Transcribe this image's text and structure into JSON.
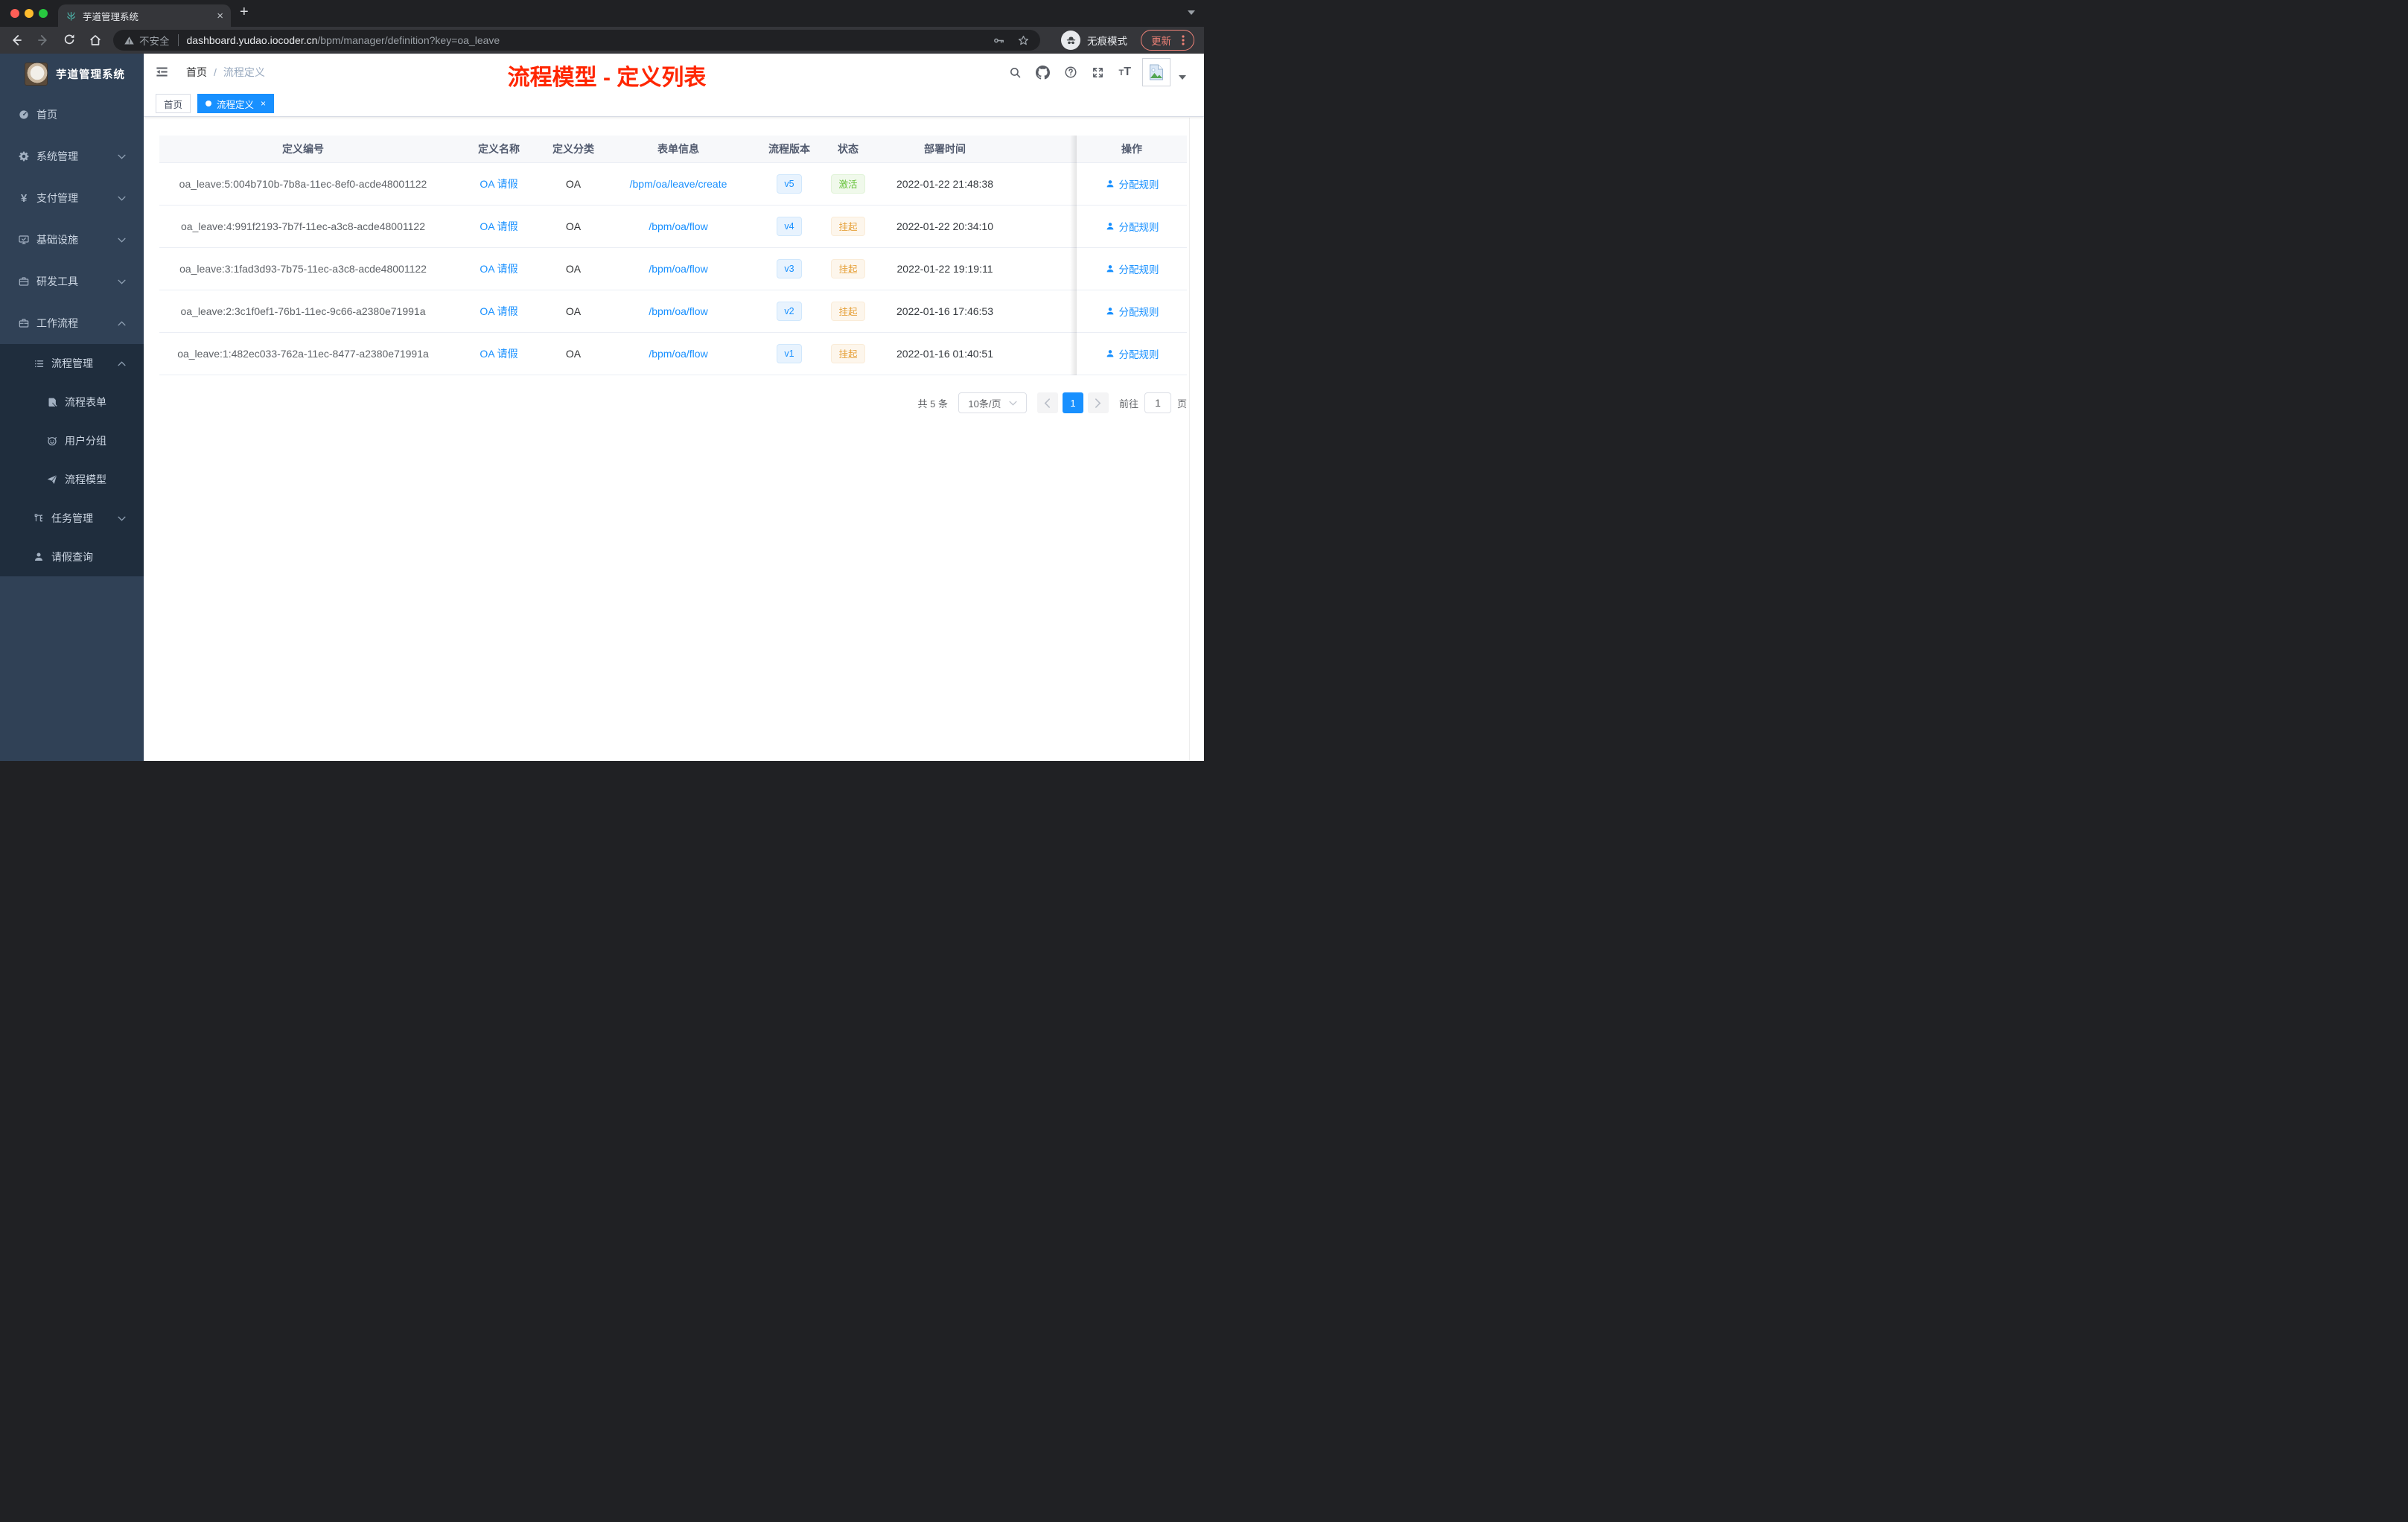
{
  "colors": {
    "accent_blue": "#1890ff",
    "success_green": "#67c23a",
    "warning_orange": "#e6a23c",
    "annotation_red": "#ff2600",
    "sidebar_bg": "#304156",
    "sidebar_nested_bg": "#1f2d3d",
    "chrome_dark": "#202124"
  },
  "browser": {
    "tab_title": "芋道管理系统",
    "close_glyph": "×",
    "newtab_glyph": "+",
    "security_label": "不安全",
    "url_host": "dashboard.yudao.iocoder.cn",
    "url_path": "/bpm/manager/definition?key=oa_leave",
    "incognito_label": "无痕模式",
    "update_label": "更新"
  },
  "sidebar": {
    "logo_title": "芋道管理系统",
    "items": [
      {
        "key": "home",
        "label": "首页",
        "icon": "dashboard-icon",
        "level": 1,
        "chevron": null,
        "nested": false
      },
      {
        "key": "system",
        "label": "系统管理",
        "icon": "gear-icon",
        "level": 1,
        "chevron": "down",
        "nested": false
      },
      {
        "key": "payment",
        "label": "支付管理",
        "icon": "yen-icon",
        "level": 1,
        "chevron": "down",
        "nested": false
      },
      {
        "key": "infrastructure",
        "label": "基础设施",
        "icon": "monitor-icon",
        "level": 1,
        "chevron": "down",
        "nested": false
      },
      {
        "key": "dev-tools",
        "label": "研发工具",
        "icon": "toolbox-icon",
        "level": 1,
        "chevron": "down",
        "nested": false
      },
      {
        "key": "workflow",
        "label": "工作流程",
        "icon": "briefcase-icon",
        "level": 1,
        "chevron": "up",
        "nested": false
      },
      {
        "key": "process-manage",
        "label": "流程管理",
        "icon": "list-icon",
        "level": 2,
        "chevron": "up",
        "nested": true
      },
      {
        "key": "process-form",
        "label": "流程表单",
        "icon": "form-edit-icon",
        "level": 3,
        "chevron": null,
        "nested": true
      },
      {
        "key": "user-group",
        "label": "用户分组",
        "icon": "robot-icon",
        "level": 3,
        "chevron": null,
        "nested": true
      },
      {
        "key": "process-model",
        "label": "流程模型",
        "icon": "paper-plane-icon",
        "level": 3,
        "chevron": null,
        "nested": true
      },
      {
        "key": "task-manage",
        "label": "任务管理",
        "icon": "tree-icon",
        "level": 2,
        "chevron": "down",
        "nested": true
      },
      {
        "key": "leave-query",
        "label": "请假查询",
        "icon": "user-icon",
        "level": 2,
        "chevron": null,
        "nested": true
      }
    ]
  },
  "navbar": {
    "breadcrumb": [
      "首页",
      "流程定义"
    ],
    "breadcrumb_sep": "/",
    "annotation": "流程模型 - 定义列表",
    "icons": [
      {
        "key": "search",
        "icon": "search-icon"
      },
      {
        "key": "github",
        "icon": "github-icon"
      },
      {
        "key": "help",
        "icon": "question-icon"
      },
      {
        "key": "fullscreen",
        "icon": "fullscreen-icon"
      },
      {
        "key": "font-size",
        "icon": "fontsize-icon"
      }
    ]
  },
  "tags": [
    {
      "key": "home",
      "label": "首页",
      "active": false,
      "closable": false
    },
    {
      "key": "process-definition",
      "label": "流程定义",
      "active": true,
      "closable": true,
      "close_glyph": "×"
    }
  ],
  "table": {
    "columns": [
      "定义编号",
      "定义名称",
      "定义分类",
      "表单信息",
      "流程版本",
      "状态",
      "部署时间",
      "操作"
    ],
    "rows": [
      {
        "id": "oa_leave:5:004b710b-7b8a-11ec-8ef0-acde48001122",
        "name": "OA 请假",
        "category": "OA",
        "form": "/bpm/oa/leave/create",
        "version": "v5",
        "status": "激活",
        "status_type": "success",
        "time": "2022-01-22 21:48:38",
        "action": "分配规则"
      },
      {
        "id": "oa_leave:4:991f2193-7b7f-11ec-a3c8-acde48001122",
        "name": "OA 请假",
        "category": "OA",
        "form": "/bpm/oa/flow",
        "version": "v4",
        "status": "挂起",
        "status_type": "warning",
        "time": "2022-01-22 20:34:10",
        "action": "分配规则"
      },
      {
        "id": "oa_leave:3:1fad3d93-7b75-11ec-a3c8-acde48001122",
        "name": "OA 请假",
        "category": "OA",
        "form": "/bpm/oa/flow",
        "version": "v3",
        "status": "挂起",
        "status_type": "warning",
        "time": "2022-01-22 19:19:11",
        "action": "分配规则"
      },
      {
        "id": "oa_leave:2:3c1f0ef1-76b1-11ec-9c66-a2380e71991a",
        "name": "OA 请假",
        "category": "OA",
        "form": "/bpm/oa/flow",
        "version": "v2",
        "status": "挂起",
        "status_type": "warning",
        "time": "2022-01-16 17:46:53",
        "action": "分配规则"
      },
      {
        "id": "oa_leave:1:482ec033-762a-11ec-8477-a2380e71991a",
        "name": "OA 请假",
        "category": "OA",
        "form": "/bpm/oa/flow",
        "version": "v1",
        "status": "挂起",
        "status_type": "warning",
        "time": "2022-01-16 01:40:51",
        "action": "分配规则"
      }
    ]
  },
  "pagination": {
    "total_label": "共 5 条",
    "page_size": "10条/页",
    "current_page": "1",
    "jumper_prefix": "前往",
    "jumper_value": "1",
    "jumper_suffix": "页"
  }
}
